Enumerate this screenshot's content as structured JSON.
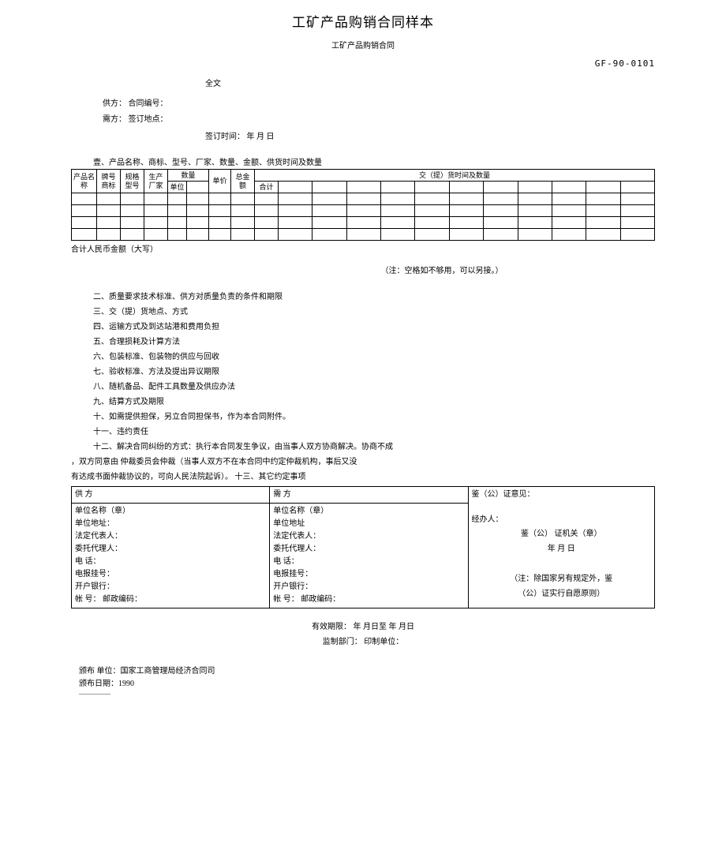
{
  "title": "工矿产品购销合同样本",
  "subtitle": "工矿产品购销合同",
  "code": "GF-90-0101",
  "full_text": "全文",
  "supplier_line": "供方：  合同编号：",
  "demander_line": "需方：  签订地点：",
  "sign_time": "签订时间：  年  月  日",
  "section1": "壹、产品名称、商标、型号、厂家、数量、金额、供货时间及数量",
  "th": {
    "product_name": "产品名称",
    "brand": "牌号 商标",
    "spec": "规格 型号",
    "maker": "生产 厂家",
    "qty_label": "数量",
    "unit_label": "单位",
    "unit_price": "单价",
    "total_amount": "总金 额",
    "delivery_time_qty": "交（提）货时间及数量",
    "subtotal": "合计"
  },
  "total_rmb": "合计人民币金额（大写）",
  "note_space": "（注：空格如不够用，可以另接。）",
  "clauses": {
    "c2": "二、质量要求技术标准、供方对质量负责的条件和期限",
    "c3": "三、交（提）货地点、方式",
    "c4": "四、运输方式及到达站港和费用负担",
    "c5": "五、合理损耗及计算方法",
    "c6": "六、包装标准、包装物的供应与回收",
    "c7": "七、验收标准、方法及提出异议期限",
    "c8": "八、随机备品、配件工具数量及供应办法",
    "c9": "九、结算方式及期限",
    "c10": "十、如需提供担保，另立合同担保书，作为本合同附件。",
    "c11": "十一、违约责任",
    "c12": "十二、解决合同纠纷的方式：执行本合同发生争议，由当事人双方协商解决。协商不成",
    "c12b": "，双方同意由  仲裁委员会仲裁（当事人双方不在本合同中约定仲裁机构，事后又没",
    "c12c": "有达成书面仲裁协议的，可向人民法院起诉）。  十三、其它约定事项"
  },
  "sig": {
    "supplier_header": "供 方",
    "demander_header": "需 方",
    "notary_header": "鉴（公）证意见：",
    "unit_name_seal": "单位名称（章）",
    "unit_addr_colon": "单位地址：",
    "unit_addr": "单位地址",
    "legal_rep": "法定代表人：",
    "agent": "委托代理人：",
    "phone": "电    话：",
    "phone2": "电  话：",
    "telegram": "电报挂号：",
    "bank": "开户银行：",
    "account": "帐  号：  邮政编码：",
    "handler": "经办人：",
    "seal": "鉴（公）  证机关（章）",
    "date": "年       月       日",
    "note": "（注：除国家另有规定外，鉴",
    "note2": "（公）证实行自愿原则）"
  },
  "valid": "有效期限：  年  月日至  年  月日",
  "supervise": "监制部门：                               印制单位：",
  "issue_unit": "颁布 单位：国家工商管理局经济合同司",
  "issue_date": "颁布日期：1990"
}
